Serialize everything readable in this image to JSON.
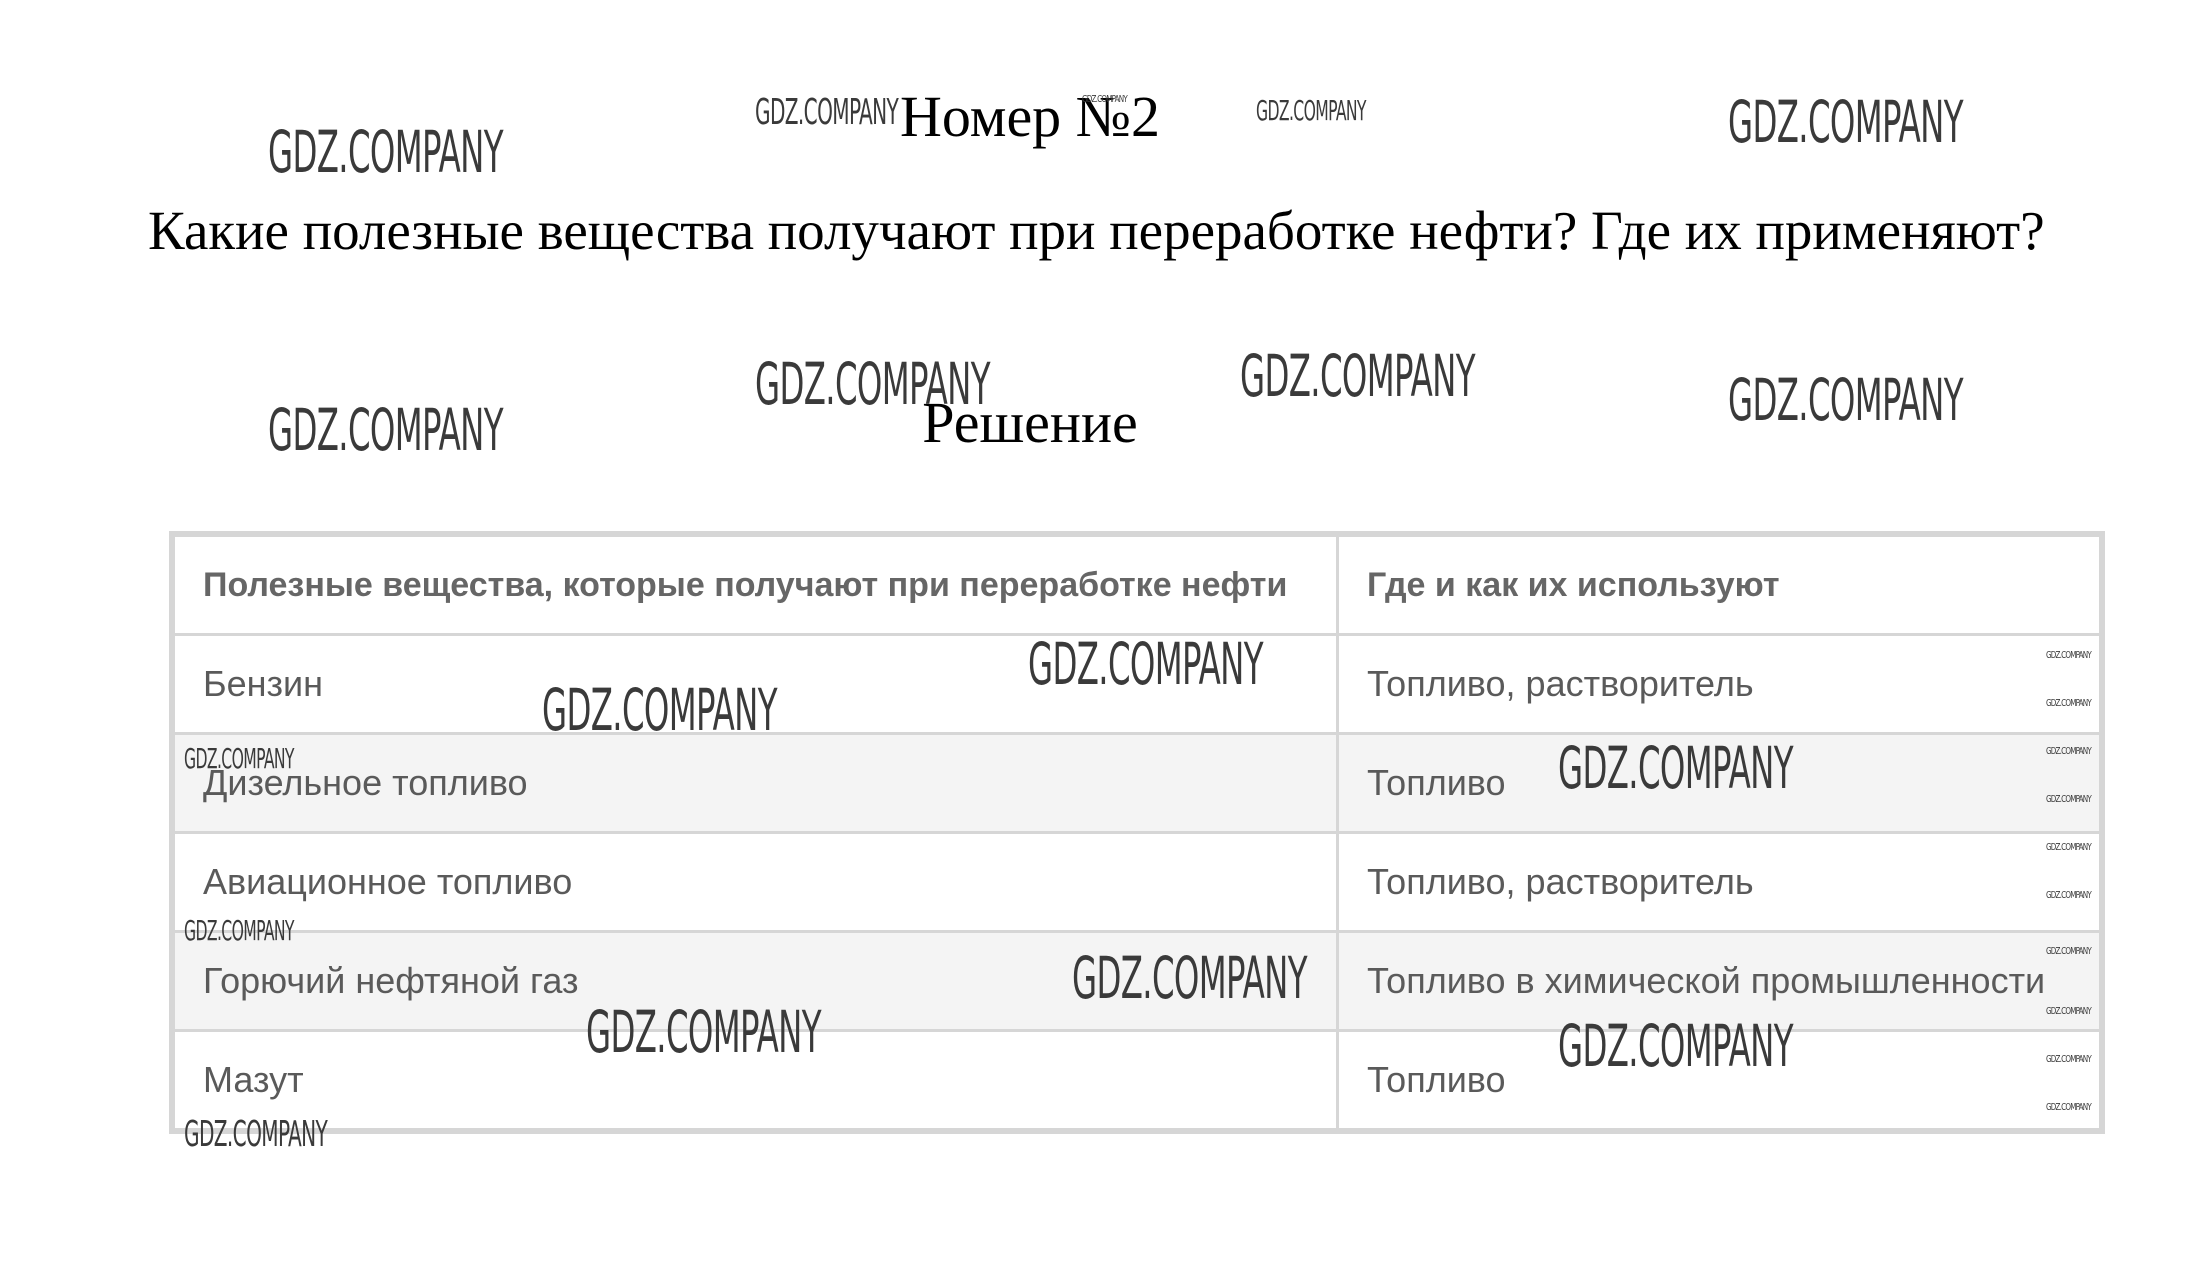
{
  "header": {
    "title": "Номер №2"
  },
  "question": {
    "text": "Какие полезные вещества получают при переработке нефти? Где их применяют?"
  },
  "solution": {
    "label": "Решение"
  },
  "table": {
    "headers": [
      "Полезные вещества, которые получают при переработке нефти",
      "Где и как их используют"
    ],
    "rows": [
      [
        "Бензин",
        "Топливо, растворитель"
      ],
      [
        "Дизельное топливо",
        "Топливо"
      ],
      [
        "Авиационное топливо",
        "Топливо, растворитель"
      ],
      [
        "Горючий нефтяной газ",
        "Топливо в химической промышленности"
      ],
      [
        "Мазут",
        "Топливо"
      ]
    ]
  },
  "watermark": {
    "text": "GDZ.COMPANY"
  }
}
